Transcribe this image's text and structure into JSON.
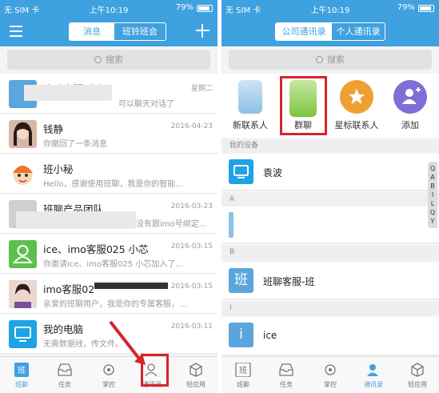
{
  "status_bar": {
    "carrier": "无 SIM 卡",
    "wifi_icon": "wifi-icon",
    "time": "上午10:19",
    "battery": "79%"
  },
  "left_screen": {
    "segment": [
      "消息",
      "班铃班会"
    ],
    "search_placeholder": "搜索",
    "conversations": [
      {
        "title": "班聊客服-班仔",
        "subtitle": "可以聊天对话了",
        "date": "星期二",
        "avatar_color": "#5aa6dc"
      },
      {
        "title": "钱静",
        "subtitle": "你撤回了一条消息",
        "date": "2016-04-23",
        "avatar_color": "#d9b7a8"
      },
      {
        "title": "班小秘",
        "subtitle": "Hello，感谢使用班聊，我是你的智能...",
        "date": "",
        "avatar_color": "#e9762b"
      },
      {
        "title": "班聊产品团队",
        "subtitle": "没有跟imo号绑定...",
        "date": "2016-03-23",
        "avatar_color": "#cfcfcf"
      },
      {
        "title": "ice、imo客服025 小芯",
        "subtitle": "你邀请ice、imo客服025 小芯加入了...",
        "date": "2016-03-15",
        "avatar_color": "#5cc04d"
      },
      {
        "title": "imo客服02",
        "subtitle": "亲爱的班聊用户，我是你的专属客服，...",
        "date": "2016-03-15",
        "avatar_color": "#c48d7a"
      },
      {
        "title": "我的电脑",
        "subtitle": "无需数据线，传文件。",
        "date": "2016-03-11",
        "avatar_color": "#1ea3e6"
      }
    ],
    "tabs": [
      {
        "label": "班聊",
        "icon": "chat-icon"
      },
      {
        "label": "任务",
        "icon": "inbox-icon"
      },
      {
        "label": "掌控",
        "icon": "gear-icon"
      },
      {
        "label": "通讯录",
        "icon": "contacts-icon"
      },
      {
        "label": "轻应用",
        "icon": "box-icon"
      }
    ]
  },
  "right_screen": {
    "segment": [
      "公司通讯录",
      "个人通讯录"
    ],
    "search_placeholder": "搜索",
    "shortcuts": [
      {
        "label": "新联系人",
        "icon": "new-contact-icon",
        "color": "#8cc2e6"
      },
      {
        "label": "群聊",
        "icon": "group-chat-icon",
        "color": "#7dc43c"
      },
      {
        "label": "星标联系人",
        "icon": "star-contact-icon",
        "color": "#f0a033"
      },
      {
        "label": "添加",
        "icon": "add-contact-icon",
        "color": "#7e6fd8"
      }
    ],
    "my_devices_header": "我的设备",
    "device": {
      "name": "袁波",
      "icon": "monitor-icon",
      "color": "#1ea3e6"
    },
    "section_a": "A",
    "section_b": "B",
    "contact_b": {
      "name": "班聊客服-班",
      "avatar_text": "班",
      "color": "#5aa6dc"
    },
    "section_i": "I",
    "contact_i": {
      "name": "ice",
      "avatar_text": "i",
      "color": "#5aa6dc"
    },
    "index_letters": [
      "Q",
      "A",
      "B",
      "I",
      "L",
      "Q",
      "Y"
    ],
    "tabs": [
      {
        "label": "班聊",
        "icon": "chat-icon"
      },
      {
        "label": "任务",
        "icon": "inbox-icon"
      },
      {
        "label": "掌控",
        "icon": "gear-icon"
      },
      {
        "label": "通讯录",
        "icon": "contacts-icon"
      },
      {
        "label": "轻应用",
        "icon": "box-icon"
      }
    ]
  },
  "colors": {
    "accent": "#3fa1df",
    "highlight": "#d6242b"
  }
}
